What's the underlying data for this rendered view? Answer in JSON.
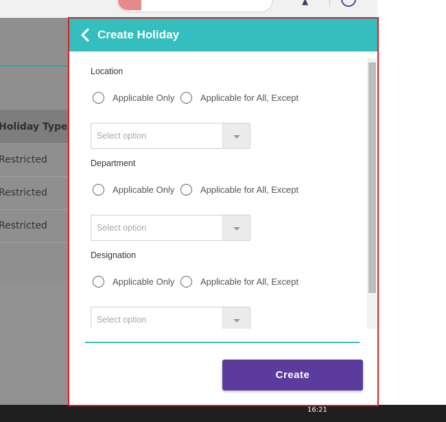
{
  "background": {
    "table_header": "Holiday Type",
    "rows": [
      "Restricted",
      "Restricted",
      "Restricted"
    ],
    "taskbar_clock": "16:21"
  },
  "modal": {
    "title": "Create Holiday",
    "sections": [
      {
        "label": "Location",
        "radio_only": "Applicable Only",
        "radio_all_except": "Applicable for All, Except",
        "select_placeholder": "Select option"
      },
      {
        "label": "Department",
        "radio_only": "Applicable Only",
        "radio_all_except": "Applicable for All, Except",
        "select_placeholder": "Select option"
      },
      {
        "label": "Designation",
        "radio_only": "Applicable Only",
        "radio_all_except": "Applicable for All, Except",
        "select_placeholder": "Select option"
      }
    ],
    "create_label": "Create"
  },
  "colors": {
    "header_teal": "#34bebe",
    "create_purple": "#5b3b9c",
    "highlight_border": "#e01a22"
  },
  "icons": {
    "back": "chevron-left-icon",
    "dropdown": "chevron-down-icon",
    "notifications": "bell-icon",
    "avatar": "user-avatar-icon"
  }
}
